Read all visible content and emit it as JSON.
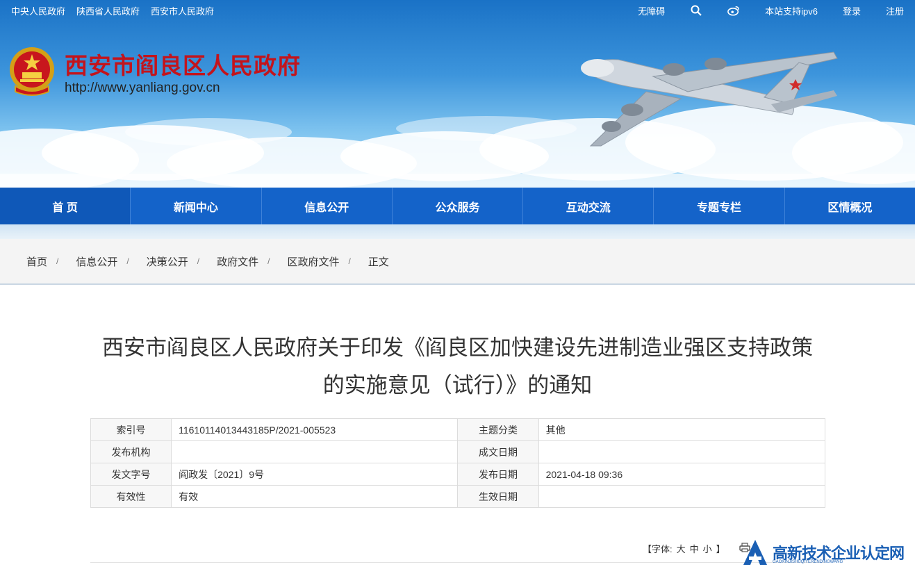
{
  "topbar": {
    "left_links": [
      "中央人民政府",
      "陕西省人民政府",
      "西安市人民政府"
    ],
    "accessibility": "无障碍",
    "ipv6": "本站支持ipv6",
    "login": "登录",
    "register": "注册"
  },
  "header": {
    "site_name": "西安市阎良区人民政府",
    "site_url": "http://www.yanliang.gov.cn"
  },
  "nav": {
    "items": [
      "首 页",
      "新闻中心",
      "信息公开",
      "公众服务",
      "互动交流",
      "专题专栏",
      "区情概况"
    ]
  },
  "breadcrumb": [
    "首页",
    "信息公开",
    "决策公开",
    "政府文件",
    "区政府文件",
    "正文"
  ],
  "breadcrumb_sep": "/",
  "article": {
    "title_line1": "西安市阎良区人民政府关于印发《阎良区加快建设先进制造业强区支持政策",
    "title_line2": "的实施意见（试行）》的通知"
  },
  "meta": {
    "index_label": "索引号",
    "index_value": "11610114013443185P/2021-005523",
    "topic_label": "主题分类",
    "topic_value": "其他",
    "issuer_label": "发布机构",
    "issuer_value": "",
    "created_label": "成文日期",
    "created_value": "",
    "docno_label": "发文字号",
    "docno_value": "阎政发〔2021〕9号",
    "pubdate_label": "发布日期",
    "pubdate_value": "2021-04-18 09:36",
    "validity_label": "有效性",
    "validity_value": "有效",
    "effective_label": "生效日期",
    "effective_value": ""
  },
  "tools": {
    "font_open": "【字体:",
    "large": "大",
    "medium": "中",
    "small": "小",
    "font_close": "】"
  },
  "watermark": {
    "text": "高新技术企业认定网",
    "sub": "GAOXINJISHUQIYERENDINGWANG"
  },
  "colors": {
    "nav_blue": "#1463c9",
    "title_red": "#c3141c",
    "watermark_blue": "#1a5fb4"
  }
}
